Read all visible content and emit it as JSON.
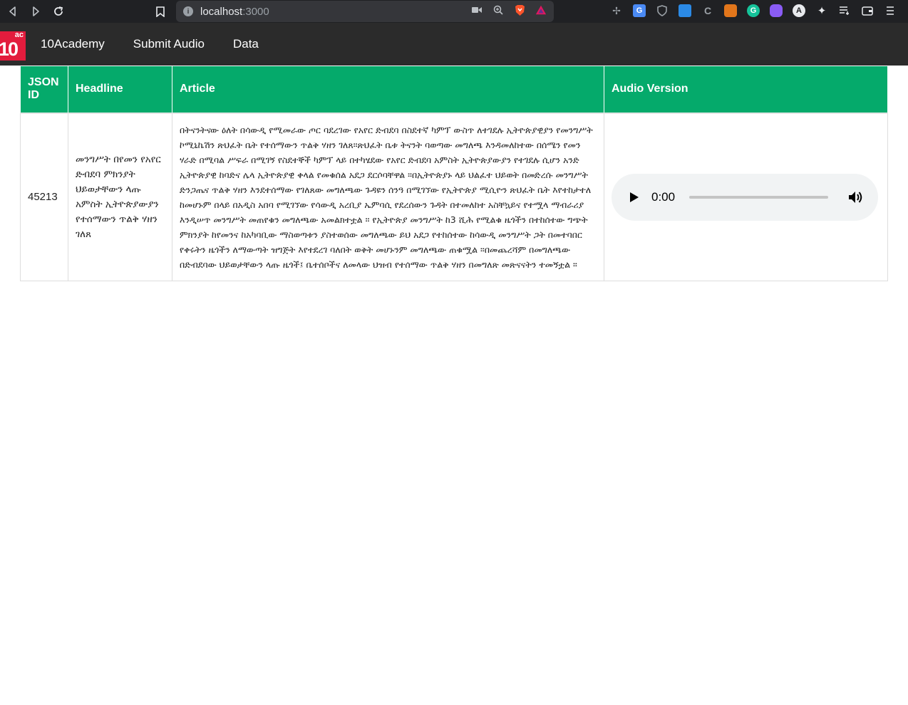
{
  "browser": {
    "url_host": "localhost",
    "url_port": ":3000"
  },
  "app": {
    "logo_text": "10",
    "logo_sup": "ac",
    "nav": [
      "10Academy",
      "Submit Audio",
      "Data"
    ]
  },
  "table": {
    "headers": [
      "JSON ID",
      "Headline",
      "Article",
      "Audio Version"
    ],
    "rows": [
      {
        "id": "45213",
        "headline": "መንግሥት በየመን የአየር ድብደባ ምክንያት ህይወታቸውን ላጡ አምስት ኢትዮጵያውያን የተሰማውን ጥልቅ ሃዘን ገለጸ",
        "article": "በትናንትናው ዕለት በሳውዲ የሚመራው ጦር ባደረገው የአየር ድብደባ በስደተኛ ካምፕ ውስጥ ለተገደሉ ኢትዮጵያዊያን የመንግሥት ኮሚኒኬሽን ጽህፈት ቤት የተሰማውን ጥልቅ ሃዘን ገለጸ።ጽህፈት ቤቱ ትናንት ባወጣው መግለጫ እንዳመለከተው በሰሜን የመን ሃራድ በሚባል ሥፍራ በሚገኝ የስደተኞች ካምፕ ላይ በተካሄደው የአየር ድብደባ አምስት ኢትዮጵያውያን የተገደሉ ሲሆን አንድ ኢትዮጵያዊ ከባድና ሌላ ኢትዮጵያዊ ቀላል የመቁሰል አደጋ ደርሶባቸዋል ።በኢትዮጵያኑ ላይ ህልፈተ ህይወት በመድረሱ መንግሥት ድንጋጤና ጥልቅ ሃዘን እንደተሰማው የገለጸው መግለጫው ጉዳዩን ሰንዓ በሚገኘው የኢትዮጵያ ሚሲዮን ጽህፈት ቤት እየተከታተለ ከመሆኑም በላይ በአዲስ አበባ የሚገኘው የሳውዲ አረቢያ ኤምባሲ የደረሰውን ጉዳት በተመለከተ አስቸኳይና የተሟላ ማብራሪያ እንዲሠጥ መንግሥት መጠየቁን መግለጫው አመልክተቷል ። የኢትዮጵያ መንግሥት ከ3 ሺሕ የሚልቁ ዜጎችን በተከሰተው ግጭት ምክንያት ከየመንና ከአካባቢው ማስወጣቱን ያስተወሰው መግለጫው ይህ አደጋ የተከሰተው ከሳውዲ መንግሥት ጋት በመተባበር የቀሩትን ዜጎችን ለማውጣት ዝግጅት እየተደረገ ባለበት ወቅት መሆኑንም መግለጫው ጠቁሟል ።በመጨረሻም በመግለጫው በድብደባው ህይወታቸውን ላጡ ዜጎች፤ ቤተሰቦችና ለመላው ህዝብ የተሰማው ጥልቅ ሃዘን በመግለጽ መጽናናትን ተመኝቷል ።",
        "audio_time": "0:00"
      }
    ]
  }
}
